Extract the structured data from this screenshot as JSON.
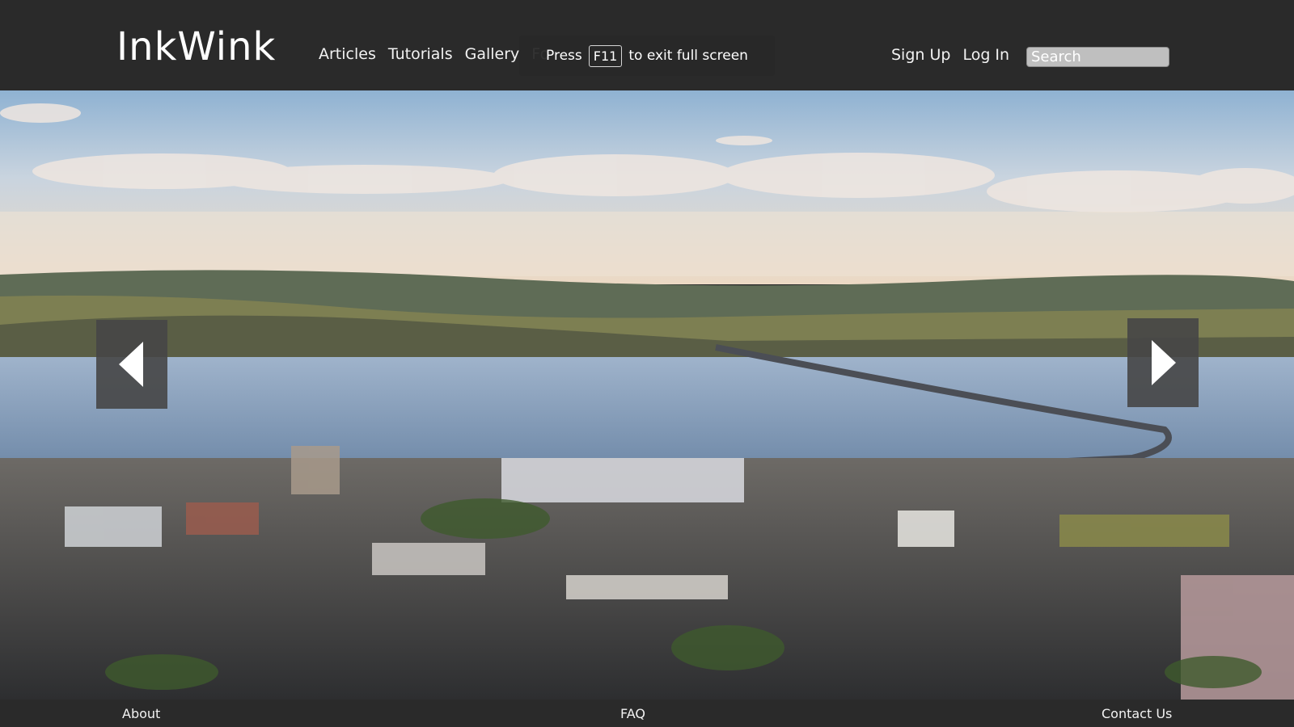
{
  "header": {
    "logo": "InkWink",
    "nav": [
      "Articles",
      "Tutorials",
      "Gallery",
      "Fo"
    ],
    "signup": "Sign Up",
    "login": "Log In",
    "search_placeholder": "Search"
  },
  "fullscreen_toast": {
    "press": "Press",
    "key": "F11",
    "message": "to exit full screen"
  },
  "hero": {
    "left_arrow_icon": "chevron-left-icon",
    "right_arrow_icon": "chevron-right-icon"
  },
  "footer": {
    "about": "About",
    "faq": "FAQ",
    "contact": "Contact Us"
  },
  "colors": {
    "header_bg": "#2a2a2a",
    "text": "#f2f2f2"
  }
}
